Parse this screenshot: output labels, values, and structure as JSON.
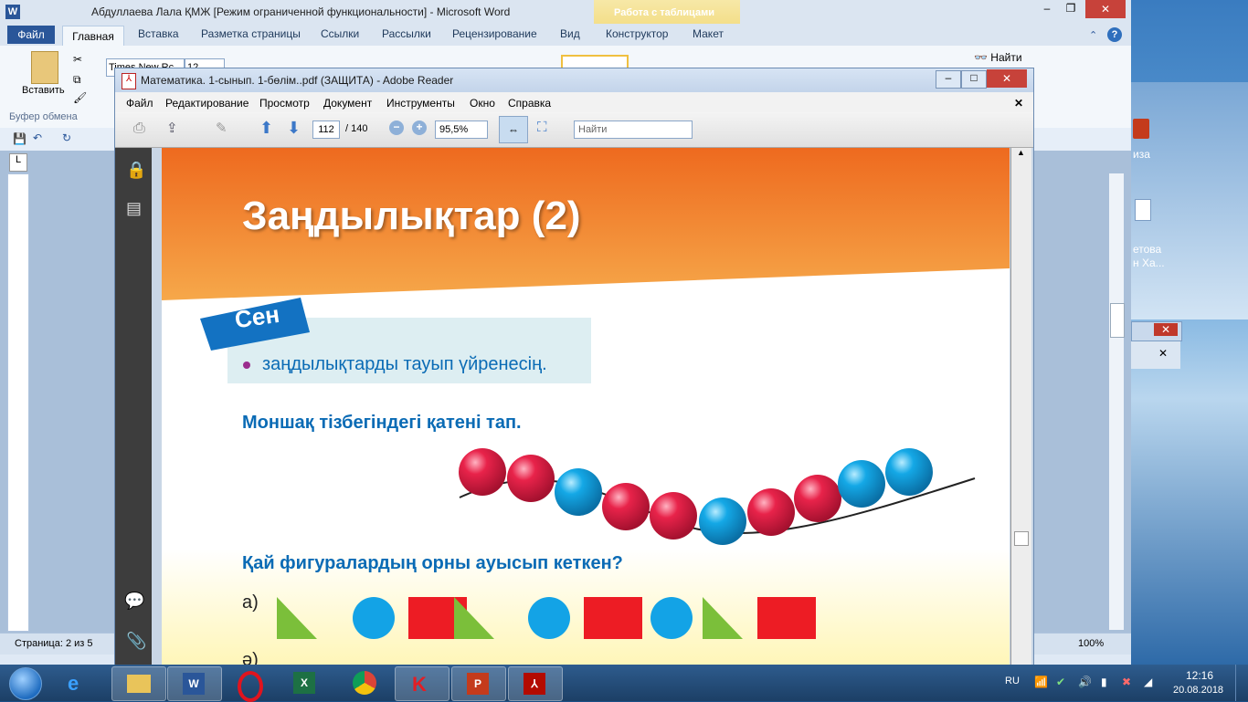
{
  "word": {
    "title": "Абдуллаева Лала ҚМЖ [Режим ограниченной функциональности]  -  Microsoft Word",
    "context_tab": "Работа с таблицами",
    "tabs": [
      "Файл",
      "Главная",
      "Вставка",
      "Разметка страницы",
      "Ссылки",
      "Рассылки",
      "Рецензирование",
      "Вид",
      "Конструктор",
      "Макет"
    ],
    "paste_label": "Вставить",
    "clipboard_label": "Буфер обмена",
    "font_name": "Times New Rc",
    "font_size": "12",
    "find_label": "Найти",
    "status_page": "Страница: 2 из 5",
    "zoom": "100%"
  },
  "acrobat": {
    "title": "Математика. 1-сынып. 1-бөлім..pdf (ЗАЩИТА) - Adobe Reader",
    "menu": [
      "Файл",
      "Редактирование",
      "Просмотр",
      "Документ",
      "Инструменты",
      "Окно",
      "Справка"
    ],
    "page_current": "112",
    "page_total": "/ 140",
    "zoom": "95,5%",
    "find_placeholder": "Найти"
  },
  "pdf": {
    "heading": "Заңдылықтар (2)",
    "badge": "Сен",
    "goal": "заңдылықтарды тауып үйренесің.",
    "task1": "Моншақ тізбегіндегі қатені тап.",
    "beads": [
      "red",
      "red",
      "blue",
      "red",
      "red",
      "blue",
      "red",
      "red",
      "blue",
      "blue"
    ],
    "task2": "Қай фигуралардың орны ауысып кеткен?",
    "label_a": "а)",
    "label_b": "ә)",
    "shapes": [
      "triangle",
      "circle",
      "square",
      "triangle",
      "circle",
      "square",
      "circle",
      "triangle",
      "square"
    ]
  },
  "side": {
    "text1": "иза",
    "text2": "етова",
    "text3": "н Ха..."
  },
  "taskbar": {
    "lang": "RU",
    "time": "12:16",
    "date": "20.08.2018"
  },
  "colors": {
    "orange": "#f07a22",
    "blue_text": "#0a6bb5",
    "bead_red": "#e8234a",
    "bead_blue": "#14a8e6",
    "shape_green": "#7bbf3a",
    "shape_blue": "#13a3e6",
    "shape_red": "#ed1c24"
  }
}
